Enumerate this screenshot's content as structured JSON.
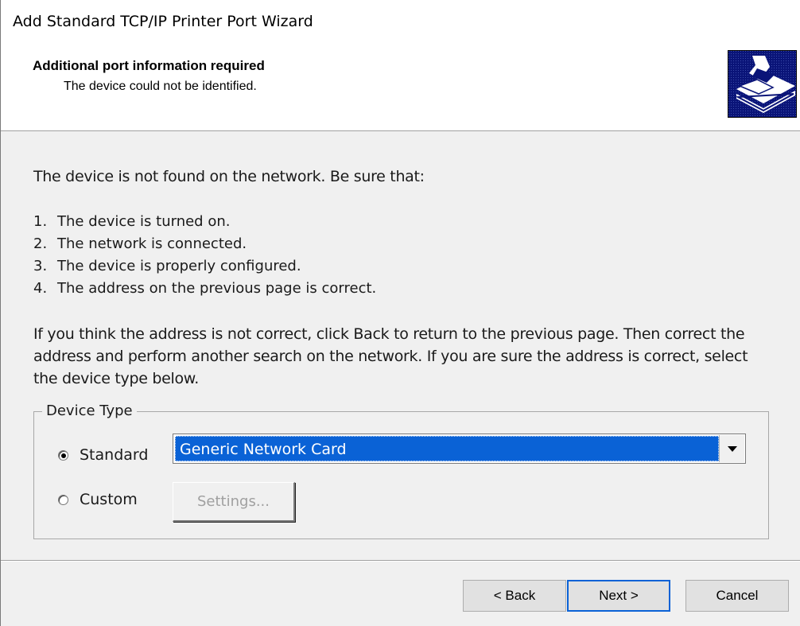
{
  "window": {
    "title": "Add Standard TCP/IP Printer Port Wizard"
  },
  "header": {
    "title": "Additional port information required",
    "subtitle": "The device could not be identified.",
    "image_icon": "printer-wizard-icon"
  },
  "body": {
    "intro": "The device is not found on the network.  Be sure that:",
    "checklist": [
      {
        "num": "1.",
        "text": "The device is turned on."
      },
      {
        "num": "2.",
        "text": "The network is connected."
      },
      {
        "num": "3.",
        "text": "The device is properly configured."
      },
      {
        "num": "4.",
        "text": "The address on the previous page is correct."
      }
    ],
    "paragraph": "If you think the address is not correct, click Back to return to the previous page.  Then correct the address and perform another search on the network.  If you are sure the address is correct, select the device type below."
  },
  "device_type": {
    "group_label": "Device Type",
    "standard_label": "Standard",
    "standard_checked": true,
    "custom_label": "Custom",
    "custom_checked": false,
    "standard_selected": "Generic Network Card",
    "settings_label": "Settings..."
  },
  "footer": {
    "back_label": "< Back",
    "next_label": "Next >",
    "cancel_label": "Cancel"
  },
  "colors": {
    "selection": "#0a62d6",
    "wizard_image_bg": "#0a1478"
  }
}
